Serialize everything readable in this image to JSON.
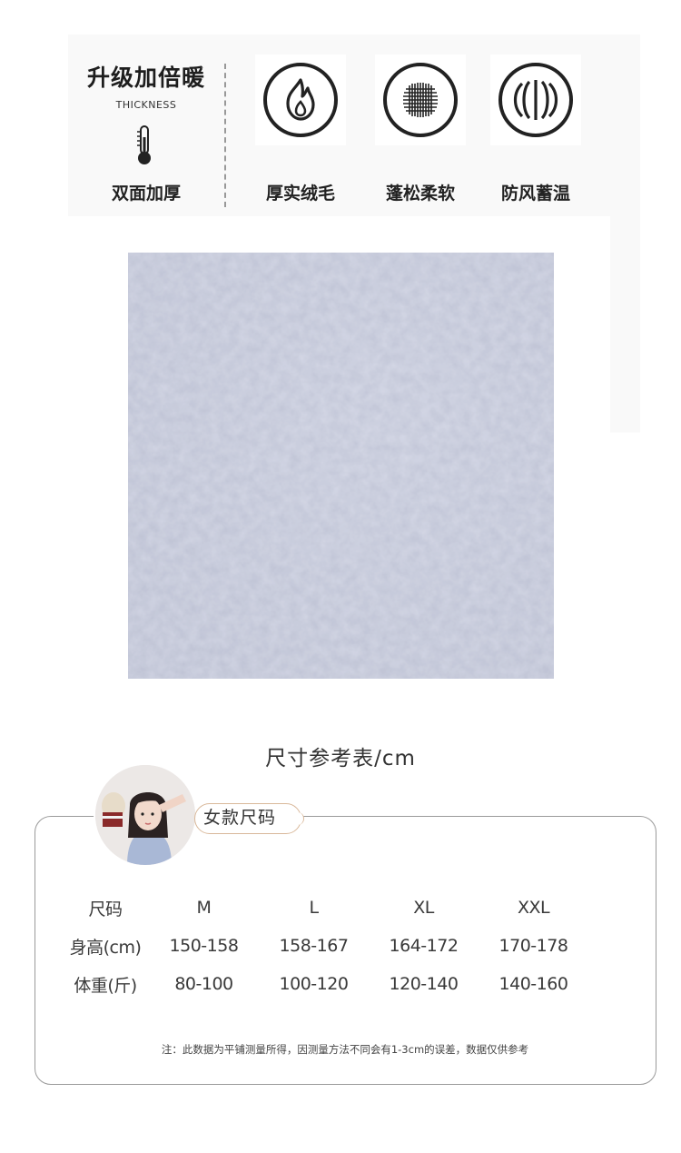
{
  "features": {
    "headline": "升级加倍暖",
    "subline": "THICKNESS",
    "left_label": "双面加厚",
    "items": [
      {
        "label": "厚实绒毛",
        "icon": "flame-icon"
      },
      {
        "label": "蓬松柔软",
        "icon": "woven-grid-icon"
      },
      {
        "label": "防风蓄温",
        "icon": "windproof-icon"
      }
    ],
    "thermometer_icon": "thermometer-icon"
  },
  "fabric": {
    "color": "#bfc4d6"
  },
  "size_chart": {
    "title": "尺寸参考表/cm",
    "tag": "女款尺码",
    "header": [
      "尺码",
      "M",
      "L",
      "XL",
      "XXL"
    ],
    "rows": [
      [
        "身高(cm)",
        "150-158",
        "158-167",
        "164-172",
        "170-178"
      ],
      [
        "体重(斤)",
        "80-100",
        "100-120",
        "120-140",
        "140-160"
      ]
    ],
    "note": "注：此数据为平铺测量所得，因测量方法不同会有1-3cm的误差，数据仅供参考"
  },
  "colors": {
    "accent_border": "#d9b89a",
    "text": "#2a2a2a"
  }
}
